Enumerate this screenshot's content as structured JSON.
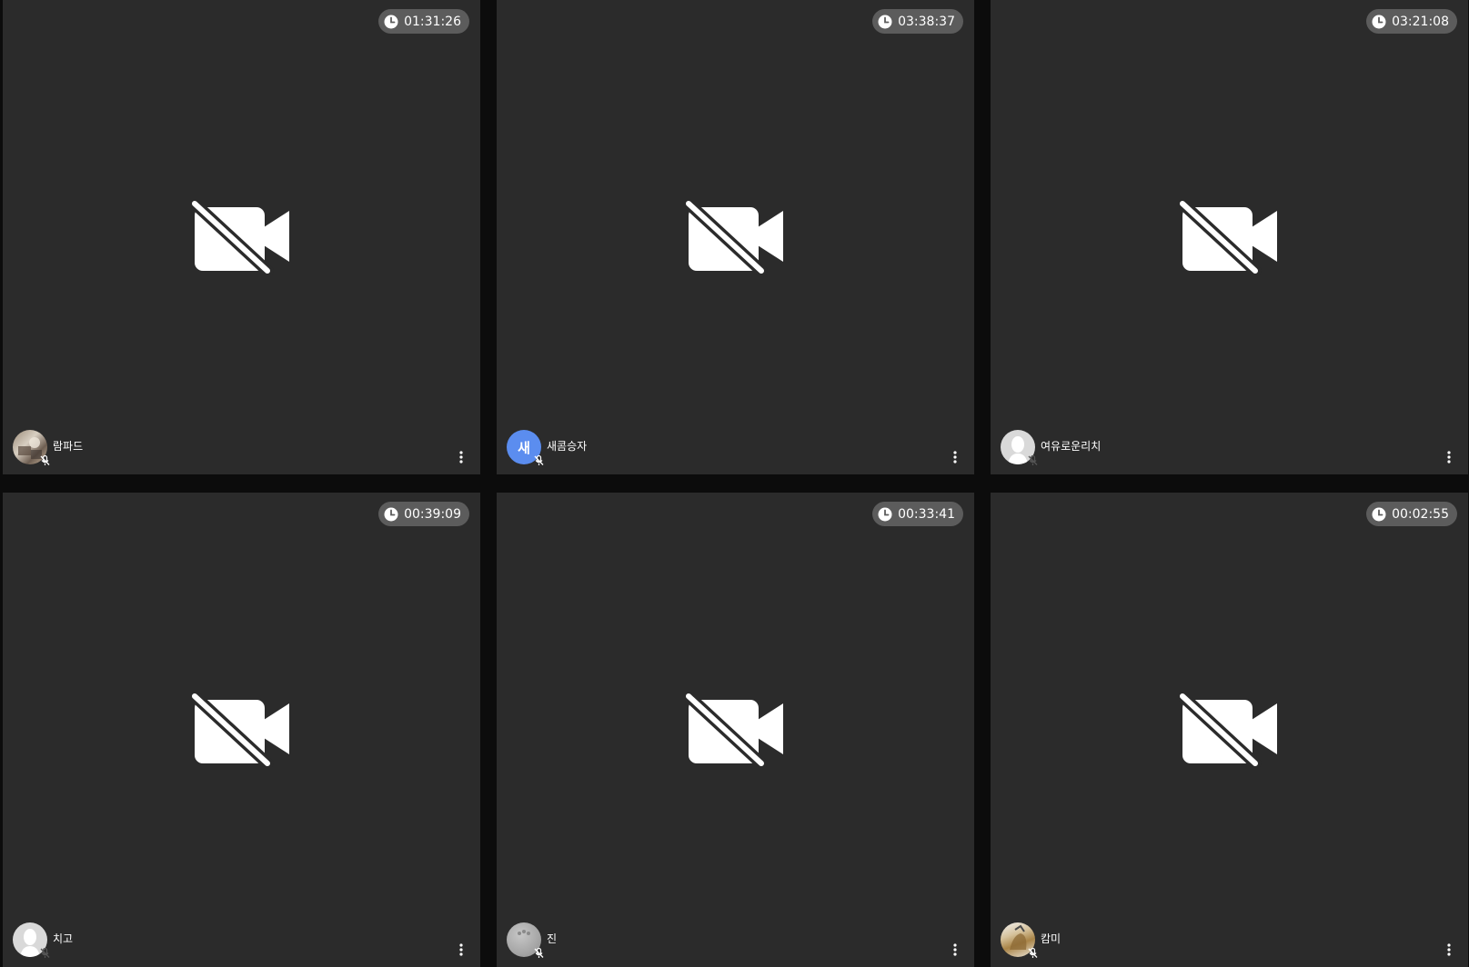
{
  "tiles": [
    {
      "timer": "01:31:26",
      "name": "람파드",
      "avatar": "photo-avatar"
    },
    {
      "timer": "03:38:37",
      "name": "새콤승자",
      "avatar": "initial-avatar",
      "initial": "새",
      "avatar_color": "#5b8def"
    },
    {
      "timer": "03:21:08",
      "name": "여유로운리치",
      "avatar": "default-avatar"
    },
    {
      "timer": "00:39:09",
      "name": "치고",
      "avatar": "default-avatar"
    },
    {
      "timer": "00:33:41",
      "name": "진",
      "avatar": "photo-avatar"
    },
    {
      "timer": "00:02:55",
      "name": "캄미",
      "avatar": "photo-avatar"
    }
  ],
  "icons": {
    "timer": "clock-icon",
    "video": "video-off-icon",
    "mic": "mic-off-icon",
    "menu": "more-vertical-icon"
  },
  "colors": {
    "background": "#0c0c0c",
    "tile": "#2b2b2b",
    "timer_pill": "#5c5c5c",
    "icon": "#ffffff"
  }
}
